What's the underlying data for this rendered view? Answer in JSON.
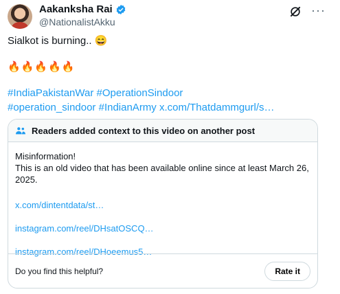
{
  "author": {
    "display_name": "Aakanksha Rai",
    "handle": "@NationalistAkku",
    "verified_icon": "verified-badge-icon",
    "accent": "#1d9bf0"
  },
  "tweet": {
    "text": "Sialkot is burning.. 😄",
    "fires": "🔥🔥🔥🔥🔥",
    "tag_line1": "#IndiaPakistanWar #OperationSindoor",
    "tag_line2": "#operation_sindoor #IndianArmy x.com/Thatdammgurl/s…"
  },
  "community_note": {
    "header": "Readers added context to this video on another post",
    "message": "Misinformation!\nThis is an old video that has been available online since at least March 26, 2025.",
    "links": [
      "x.com/dintentdata/st…",
      "instagram.com/reel/DHsatOSCQ…",
      "instagram.com/reel/DHoeemus5…"
    ],
    "question": "Do you find this helpful?",
    "rate_label": "Rate it"
  }
}
